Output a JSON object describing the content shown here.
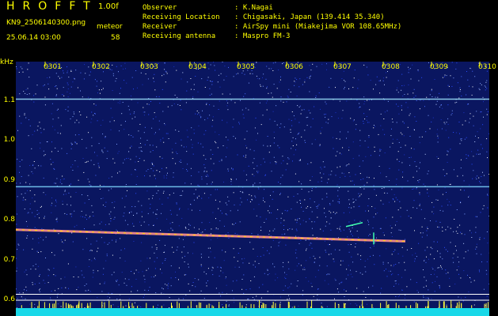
{
  "header": {
    "app_title": "HROFFT",
    "version": "1.00f",
    "filename": "KN9_2506140300.png",
    "datetime": "25.06.14 03:00",
    "meteor_label": "meteor",
    "meteor_count": "58"
  },
  "info": [
    {
      "label": "Observer",
      "value": ": K.Nagai"
    },
    {
      "label": "Receiving Location",
      "value": ": Chigasaki, Japan (139.414 35.340)"
    },
    {
      "label": "Receiver",
      "value": ": AirSpy mini (Miakejima VOR 108.65MHz)"
    },
    {
      "label": "Receiving antenna",
      "value": ": Maspro FM-3"
    }
  ],
  "spectrogram": {
    "y_unit": "kHz",
    "y_ticks": [
      "1.1",
      "1.0",
      "0.9",
      "0.8",
      "0.7",
      "0.6"
    ],
    "x_ticks": [
      "0301",
      "0302",
      "0303",
      "0304",
      "0305",
      "0306",
      "0307",
      "0308",
      "0309",
      "0310"
    ],
    "colors": {
      "background": "#0a1660",
      "signal": "#ff3030",
      "line": "#7fd8ff",
      "bottom": "#18d8e8",
      "label": "#ffff00"
    }
  }
}
